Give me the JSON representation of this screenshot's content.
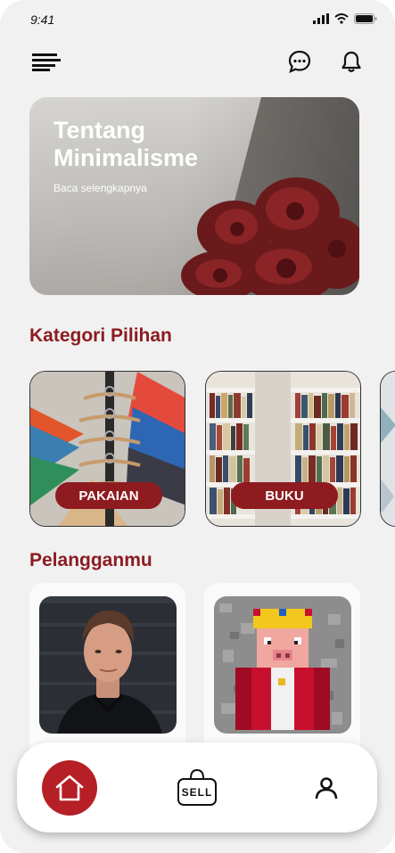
{
  "status_bar": {
    "time": "9:41"
  },
  "header": {
    "menu_icon": "menu-icon",
    "chat_icon": "chat-bubble-icon",
    "notification_icon": "bell-icon"
  },
  "hero": {
    "title": "Tentang Minimalisme",
    "link": "Baca selengkapnya"
  },
  "categories": {
    "title": "Kategori Pilihan",
    "items": [
      {
        "label": "PAKAIAN"
      },
      {
        "label": "BUKU"
      }
    ]
  },
  "subscribers": {
    "title": "Pelangganmu"
  },
  "bottom_nav": {
    "home_icon": "home-icon",
    "sell_label": "SELL",
    "profile_icon": "user-icon"
  },
  "colors": {
    "accent": "#8e1b20",
    "home_button": "#b51f25",
    "background": "#f1f1f1"
  }
}
